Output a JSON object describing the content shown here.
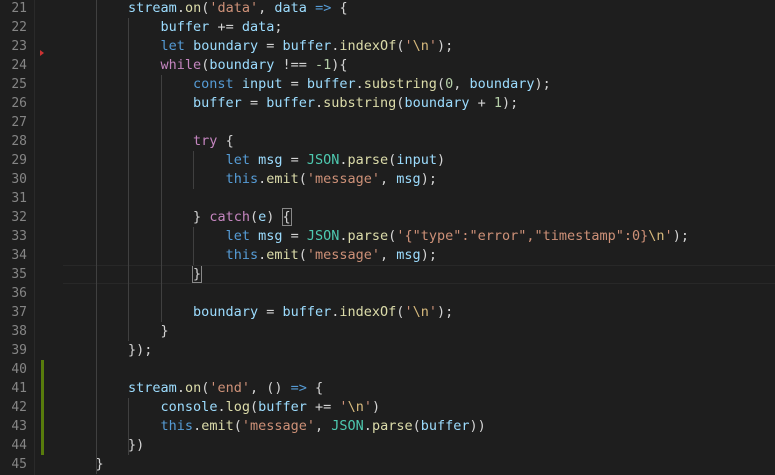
{
  "editor": {
    "background": "#1e1e1e",
    "active_line_number": 35,
    "line_numbers": [
      "21",
      "22",
      "23",
      "24",
      "25",
      "26",
      "27",
      "28",
      "29",
      "30",
      "31",
      "32",
      "33",
      "34",
      "35",
      "36",
      "37",
      "38",
      "39",
      "40",
      "41",
      "42",
      "43",
      "44",
      "45"
    ],
    "git_modified_lines": [
      40,
      41,
      42,
      43,
      44
    ],
    "lines": [
      {
        "indent": "        ",
        "tokens": [
          [
            "stream",
            "var"
          ],
          [
            ".",
            "plain"
          ],
          [
            "on",
            "fn"
          ],
          [
            "(",
            "plain"
          ],
          [
            "'data'",
            "str"
          ],
          [
            ", ",
            "plain"
          ],
          [
            "data",
            "var"
          ],
          [
            " ",
            "plain"
          ],
          [
            "=>",
            "kw"
          ],
          [
            " {",
            "plain"
          ]
        ]
      },
      {
        "indent": "            ",
        "tokens": [
          [
            "buffer",
            "var"
          ],
          [
            " += ",
            "plain"
          ],
          [
            "data",
            "var"
          ],
          [
            ";",
            "plain"
          ]
        ]
      },
      {
        "indent": "            ",
        "tokens": [
          [
            "let",
            "kw"
          ],
          [
            " ",
            "plain"
          ],
          [
            "boundary",
            "var"
          ],
          [
            " = ",
            "plain"
          ],
          [
            "buffer",
            "var"
          ],
          [
            ".",
            "plain"
          ],
          [
            "indexOf",
            "fn"
          ],
          [
            "(",
            "plain"
          ],
          [
            "'",
            "str"
          ],
          [
            "\\n",
            "esc"
          ],
          [
            "'",
            "str"
          ],
          [
            ");",
            "plain"
          ]
        ]
      },
      {
        "indent": "            ",
        "tokens": [
          [
            "while",
            "ctrl"
          ],
          [
            "(",
            "plain"
          ],
          [
            "boundary",
            "var"
          ],
          [
            " !== ",
            "plain"
          ],
          [
            "-1",
            "num"
          ],
          [
            "){",
            "plain"
          ]
        ]
      },
      {
        "indent": "                ",
        "tokens": [
          [
            "const",
            "kw"
          ],
          [
            " ",
            "plain"
          ],
          [
            "input",
            "var"
          ],
          [
            " = ",
            "plain"
          ],
          [
            "buffer",
            "var"
          ],
          [
            ".",
            "plain"
          ],
          [
            "substring",
            "fn"
          ],
          [
            "(",
            "plain"
          ],
          [
            "0",
            "num"
          ],
          [
            ", ",
            "plain"
          ],
          [
            "boundary",
            "var"
          ],
          [
            ");",
            "plain"
          ]
        ]
      },
      {
        "indent": "                ",
        "tokens": [
          [
            "buffer",
            "var"
          ],
          [
            " = ",
            "plain"
          ],
          [
            "buffer",
            "var"
          ],
          [
            ".",
            "plain"
          ],
          [
            "substring",
            "fn"
          ],
          [
            "(",
            "plain"
          ],
          [
            "boundary",
            "var"
          ],
          [
            " + ",
            "plain"
          ],
          [
            "1",
            "num"
          ],
          [
            ");",
            "plain"
          ]
        ]
      },
      {
        "indent": "",
        "tokens": []
      },
      {
        "indent": "                ",
        "tokens": [
          [
            "try",
            "ctrl"
          ],
          [
            " {",
            "plain"
          ]
        ]
      },
      {
        "indent": "                    ",
        "tokens": [
          [
            "let",
            "kw"
          ],
          [
            " ",
            "plain"
          ],
          [
            "msg",
            "var"
          ],
          [
            " = ",
            "plain"
          ],
          [
            "JSON",
            "type"
          ],
          [
            ".",
            "plain"
          ],
          [
            "parse",
            "fn"
          ],
          [
            "(",
            "plain"
          ],
          [
            "input",
            "var"
          ],
          [
            ")",
            "plain"
          ]
        ]
      },
      {
        "indent": "                    ",
        "tokens": [
          [
            "this",
            "kw"
          ],
          [
            ".",
            "plain"
          ],
          [
            "emit",
            "fn"
          ],
          [
            "(",
            "plain"
          ],
          [
            "'message'",
            "str"
          ],
          [
            ", ",
            "plain"
          ],
          [
            "msg",
            "var"
          ],
          [
            ");",
            "plain"
          ]
        ]
      },
      {
        "indent": "",
        "tokens": []
      },
      {
        "indent": "                ",
        "tokens": [
          [
            "} ",
            "plain"
          ],
          [
            "catch",
            "ctrl"
          ],
          [
            "(",
            "plain"
          ],
          [
            "e",
            "var"
          ],
          [
            ") ",
            "plain"
          ],
          [
            "{",
            "bracket"
          ]
        ]
      },
      {
        "indent": "                    ",
        "tokens": [
          [
            "let",
            "kw"
          ],
          [
            " ",
            "plain"
          ],
          [
            "msg",
            "var"
          ],
          [
            " = ",
            "plain"
          ],
          [
            "JSON",
            "type"
          ],
          [
            ".",
            "plain"
          ],
          [
            "parse",
            "fn"
          ],
          [
            "(",
            "plain"
          ],
          [
            "'{\"type\":\"error\",\"timestamp\":0}",
            "str"
          ],
          [
            "\\n",
            "esc"
          ],
          [
            "'",
            "str"
          ],
          [
            ");",
            "plain"
          ]
        ]
      },
      {
        "indent": "                    ",
        "tokens": [
          [
            "this",
            "kw"
          ],
          [
            ".",
            "plain"
          ],
          [
            "emit",
            "fn"
          ],
          [
            "(",
            "plain"
          ],
          [
            "'message'",
            "str"
          ],
          [
            ", ",
            "plain"
          ],
          [
            "msg",
            "var"
          ],
          [
            ");",
            "plain"
          ]
        ]
      },
      {
        "indent": "                ",
        "tokens": [
          [
            "}",
            "bracket"
          ]
        ]
      },
      {
        "indent": "",
        "tokens": []
      },
      {
        "indent": "                ",
        "tokens": [
          [
            "boundary",
            "var"
          ],
          [
            " = ",
            "plain"
          ],
          [
            "buffer",
            "var"
          ],
          [
            ".",
            "plain"
          ],
          [
            "indexOf",
            "fn"
          ],
          [
            "(",
            "plain"
          ],
          [
            "'",
            "str"
          ],
          [
            "\\n",
            "esc"
          ],
          [
            "'",
            "str"
          ],
          [
            ");",
            "plain"
          ]
        ]
      },
      {
        "indent": "            ",
        "tokens": [
          [
            "}",
            "plain"
          ]
        ]
      },
      {
        "indent": "        ",
        "tokens": [
          [
            "});",
            "plain"
          ]
        ]
      },
      {
        "indent": "",
        "tokens": []
      },
      {
        "indent": "        ",
        "tokens": [
          [
            "stream",
            "var"
          ],
          [
            ".",
            "plain"
          ],
          [
            "on",
            "fn"
          ],
          [
            "(",
            "plain"
          ],
          [
            "'end'",
            "str"
          ],
          [
            ", ",
            "plain"
          ],
          [
            "() ",
            "plain"
          ],
          [
            "=>",
            "kw"
          ],
          [
            " {",
            "plain"
          ]
        ]
      },
      {
        "indent": "            ",
        "tokens": [
          [
            "console",
            "var"
          ],
          [
            ".",
            "plain"
          ],
          [
            "log",
            "fn"
          ],
          [
            "(",
            "plain"
          ],
          [
            "buffer",
            "var"
          ],
          [
            " += ",
            "plain"
          ],
          [
            "'",
            "str"
          ],
          [
            "\\n",
            "esc"
          ],
          [
            "'",
            "str"
          ],
          [
            ")",
            "plain"
          ]
        ]
      },
      {
        "indent": "            ",
        "tokens": [
          [
            "this",
            "kw"
          ],
          [
            ".",
            "plain"
          ],
          [
            "emit",
            "fn"
          ],
          [
            "(",
            "plain"
          ],
          [
            "'message'",
            "str"
          ],
          [
            ", ",
            "plain"
          ],
          [
            "JSON",
            "type"
          ],
          [
            ".",
            "plain"
          ],
          [
            "parse",
            "fn"
          ],
          [
            "(",
            "plain"
          ],
          [
            "buffer",
            "var"
          ],
          [
            "))",
            "plain"
          ]
        ]
      },
      {
        "indent": "        ",
        "tokens": [
          [
            "})",
            "plain"
          ]
        ]
      },
      {
        "indent": "    ",
        "tokens": [
          [
            "}",
            "plain"
          ]
        ]
      }
    ]
  }
}
